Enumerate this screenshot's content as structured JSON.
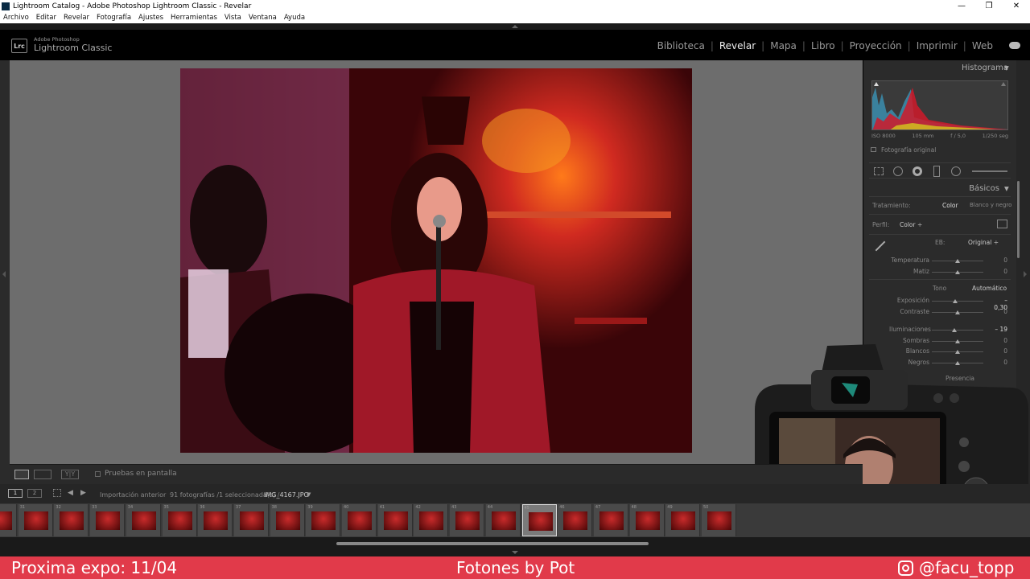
{
  "window": {
    "title": "Lightroom Catalog - Adobe Photoshop Lightroom Classic - Revelar",
    "controls": [
      "—",
      "❐",
      "✕"
    ]
  },
  "menu": [
    "Archivo",
    "Editar",
    "Revelar",
    "Fotografía",
    "Ajustes",
    "Herramientas",
    "Vista",
    "Ventana",
    "Ayuda"
  ],
  "brand": {
    "badge": "Lrc",
    "small": "Adobe Photoshop",
    "big": "Lightroom Classic"
  },
  "modules": [
    {
      "label": "Biblioteca",
      "active": false
    },
    {
      "label": "Revelar",
      "active": true
    },
    {
      "label": "Mapa",
      "active": false
    },
    {
      "label": "Libro",
      "active": false
    },
    {
      "label": "Proyección",
      "active": false
    },
    {
      "label": "Imprimir",
      "active": false
    },
    {
      "label": "Web",
      "active": false
    }
  ],
  "histogram": {
    "title": "Histograma",
    "info": [
      "ISO 8000",
      "105 mm",
      "f / 5,0",
      "1/250 seg"
    ],
    "original_label": "Fotografía original"
  },
  "basic": {
    "title": "Básicos",
    "treatment_label": "Tratamiento:",
    "treatment_color": "Color",
    "treatment_bw": "Blanco y negro",
    "profile_label": "Perfil:",
    "profile_value": "Color ÷",
    "wb_label": "EB:",
    "wb_value": "Original ÷",
    "tone_label": "Tono",
    "auto_label": "Automático",
    "sliders_wb": [
      {
        "label": "Temperatura",
        "value": "0",
        "pos": 0.5
      },
      {
        "label": "Matiz",
        "value": "0",
        "pos": 0.5
      }
    ],
    "sliders_tone": [
      {
        "label": "Exposición",
        "value": "– 0,30",
        "pos": 0.46
      },
      {
        "label": "Contraste",
        "value": "0",
        "pos": 0.5
      }
    ],
    "sliders_tone2": [
      {
        "label": "Iluminaciones",
        "value": "– 19",
        "pos": 0.43
      },
      {
        "label": "Sombras",
        "value": "0",
        "pos": 0.5
      },
      {
        "label": "Blancos",
        "value": "0",
        "pos": 0.5
      },
      {
        "label": "Negros",
        "value": "0",
        "pos": 0.5
      }
    ],
    "presence_label": "Presencia"
  },
  "toolbar": {
    "softproof_label": "Pruebas en pantalla"
  },
  "filmnav": {
    "pages": [
      "1",
      "2"
    ],
    "source": "Importación anterior",
    "count": "91 fotografías /1 seleccionada(s) /",
    "filename": "IMG_4167.JPG"
  },
  "film_numbers": [
    "30",
    "31",
    "32",
    "33",
    "34",
    "35",
    "36",
    "37",
    "38",
    "39",
    "40",
    "41",
    "42",
    "43",
    "44",
    "45",
    "46",
    "47",
    "48",
    "49",
    "50"
  ],
  "film_selected_index": 15,
  "footer": {
    "left": "Proxima expo: 11/04",
    "center": "Fotones by Pot",
    "right": "@facu_topp"
  }
}
